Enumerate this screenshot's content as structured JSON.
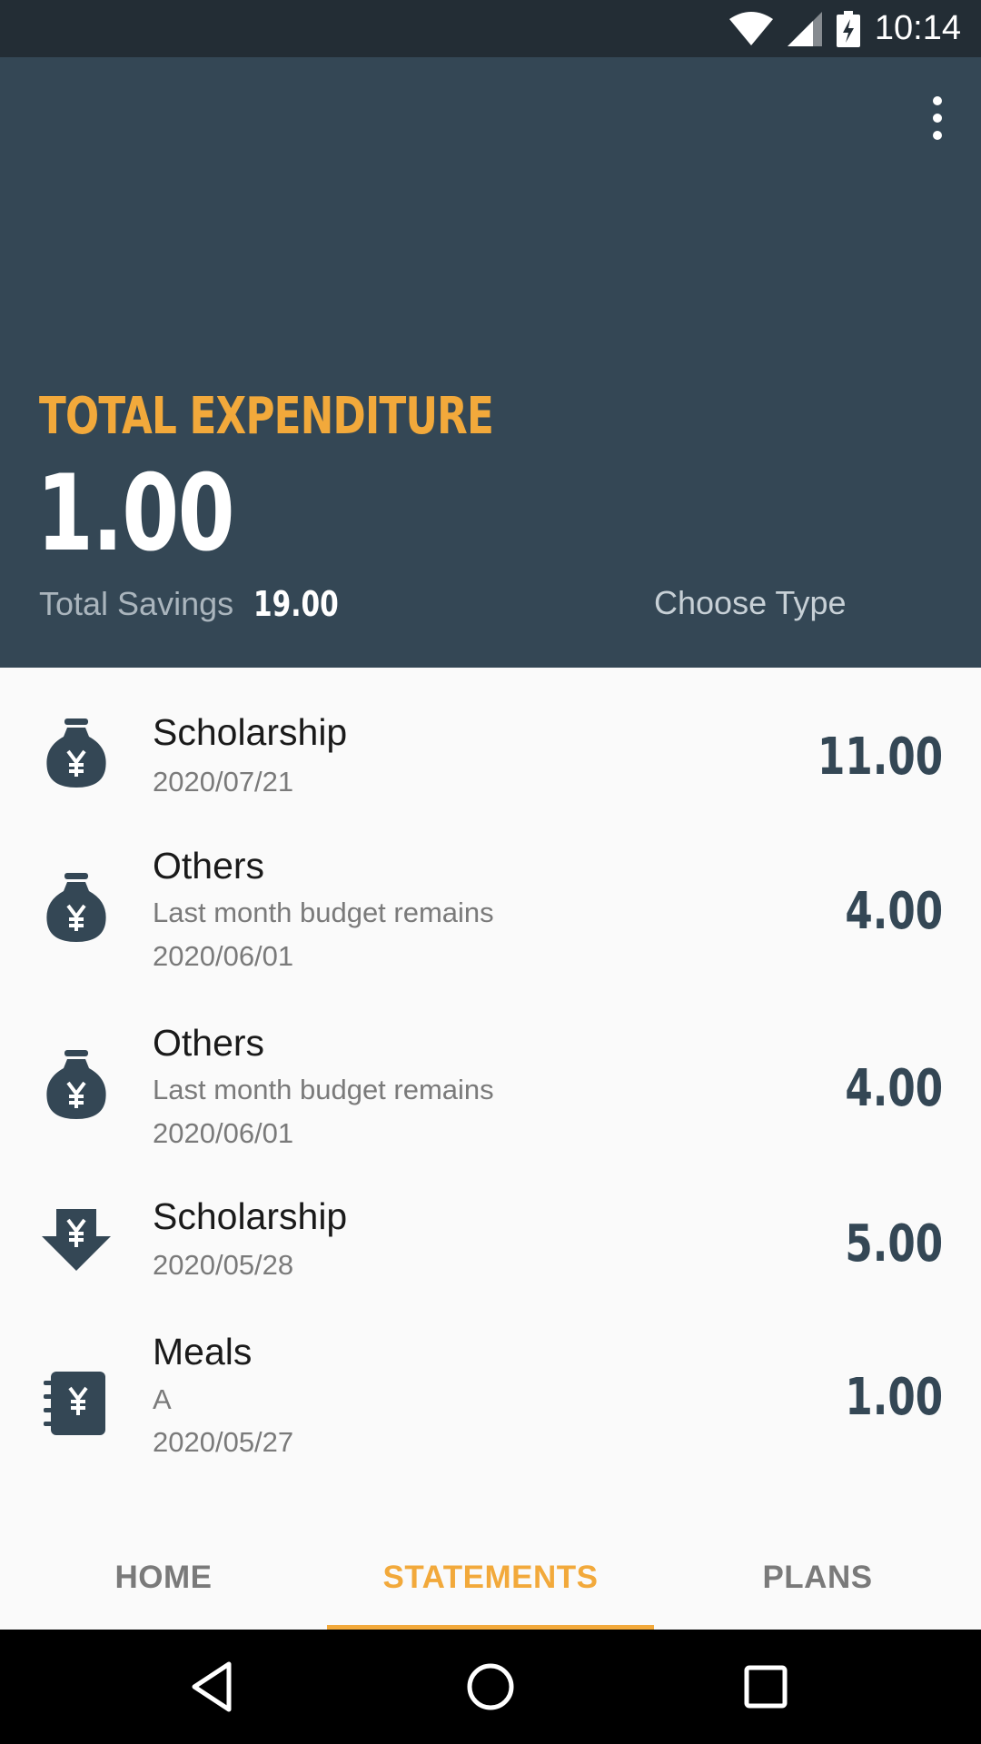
{
  "status_bar": {
    "time": "10:14"
  },
  "header": {
    "title": "TOTAL EXPENDITURE",
    "total_value": "1.00",
    "savings_label": "Total Savings",
    "savings_value": "19.00",
    "choose_type": "Choose Type"
  },
  "transactions": [
    {
      "icon": "money-bag-icon",
      "title": "Scholarship",
      "note": "",
      "date": "2020/07/21",
      "amount": "11.00"
    },
    {
      "icon": "money-bag-icon",
      "title": "Others",
      "note": "Last month budget remains",
      "date": "2020/06/01",
      "amount": "4.00"
    },
    {
      "icon": "money-bag-icon",
      "title": "Others",
      "note": "Last month budget remains",
      "date": "2020/06/01",
      "amount": "4.00"
    },
    {
      "icon": "yen-arrow-down-icon",
      "title": "Scholarship",
      "note": "",
      "date": "2020/05/28",
      "amount": "5.00"
    },
    {
      "icon": "yen-notebook-icon",
      "title": "Meals",
      "note": "A",
      "date": "2020/05/27",
      "amount": "1.00"
    }
  ],
  "tabs": [
    {
      "label": "HOME",
      "active": false
    },
    {
      "label": "STATEMENTS",
      "active": true
    },
    {
      "label": "PLANS",
      "active": false
    }
  ],
  "colors": {
    "header_bg": "#344755",
    "status_bg": "#232d35",
    "accent": "#f2a93b",
    "amount": "#344755"
  }
}
